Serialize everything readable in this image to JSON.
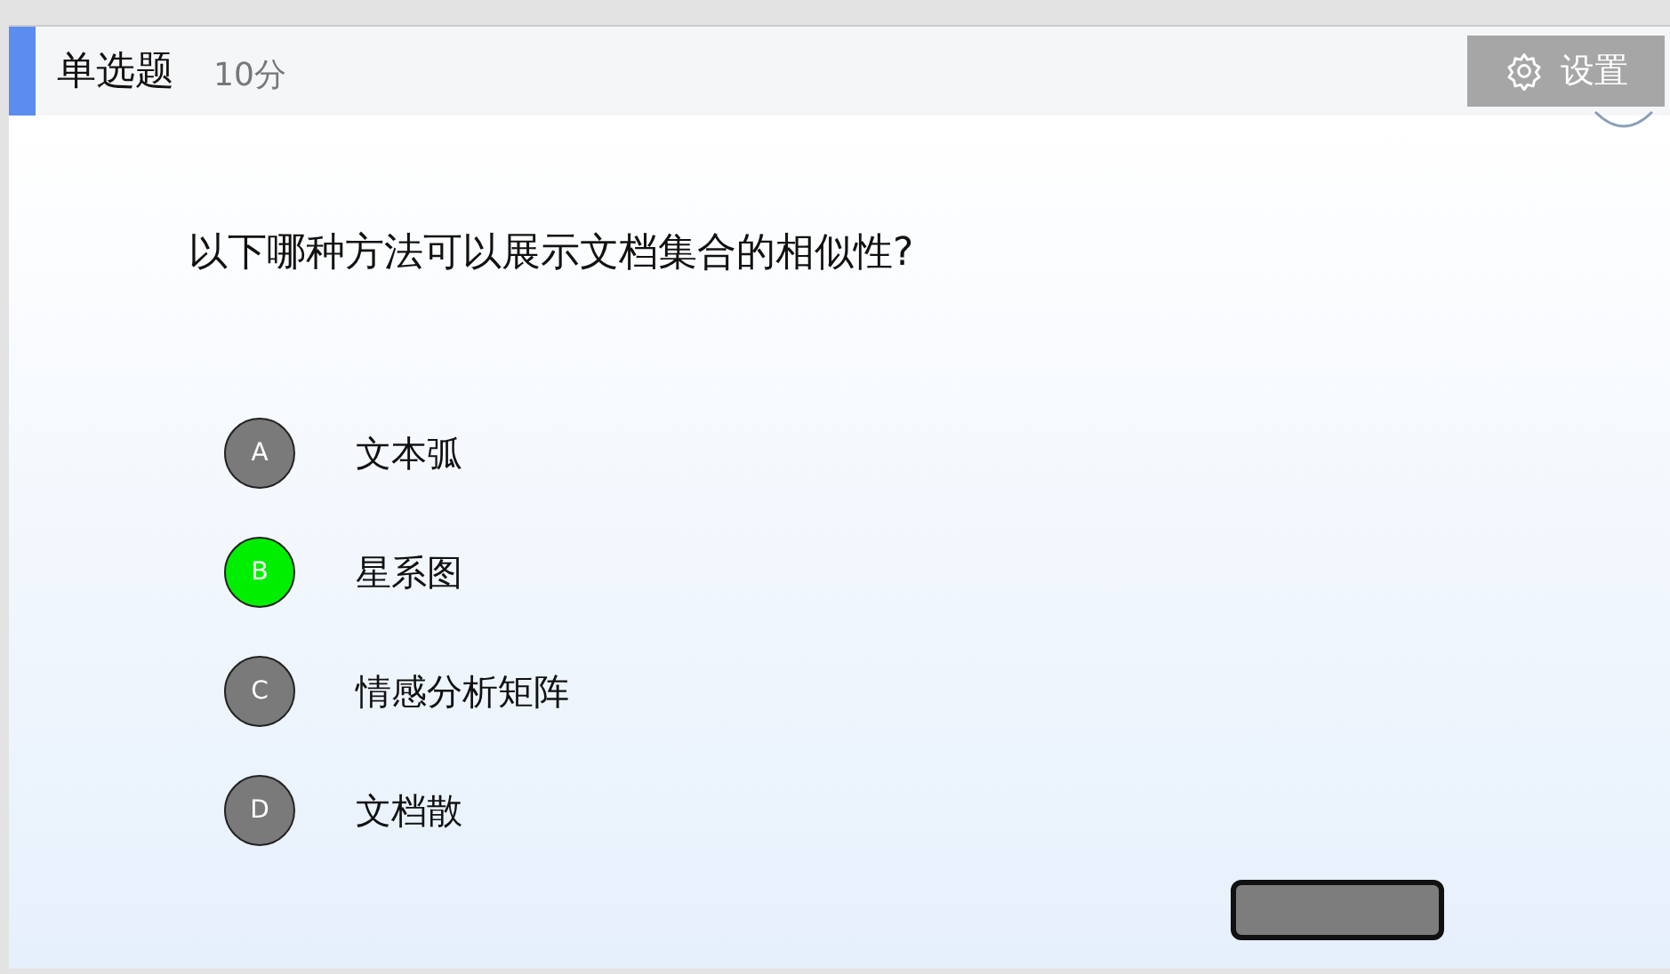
{
  "header": {
    "title": "单选题",
    "score": "10分",
    "settings_label": "设置"
  },
  "question": "以下哪种方法可以展示文档集合的相似性?",
  "options": [
    {
      "letter": "A",
      "text": "文本弧",
      "color": "#7a7a7a"
    },
    {
      "letter": "B",
      "text": "星系图",
      "color": "#00ee00"
    },
    {
      "letter": "C",
      "text": "情感分析矩阵",
      "color": "#7a7a7a"
    },
    {
      "letter": "D",
      "text": "文档散",
      "color": "#7a7a7a"
    }
  ]
}
